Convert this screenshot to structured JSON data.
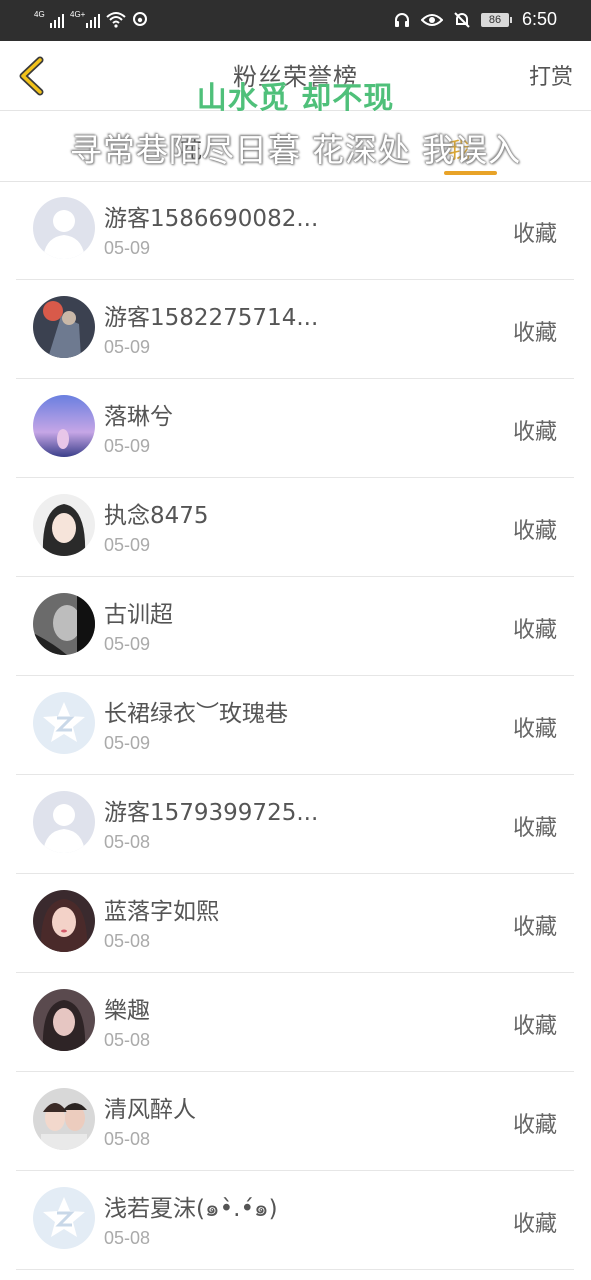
{
  "status_bar": {
    "net1": "4G",
    "net2": "4G+",
    "battery": "86",
    "time": "6:50"
  },
  "header": {
    "title": "粉丝荣誉榜",
    "right_action": "打赏",
    "overlay_text": "山水觅 却不现"
  },
  "tabs": {
    "left_label": "花",
    "right_label": "我",
    "overlay_text": "寻常巷陌尽日暮 花深处 我误入"
  },
  "list": [
    {
      "name": "游客1586690082...",
      "date": "05-09",
      "action": "收藏",
      "avatar": "default-person"
    },
    {
      "name": "游客1582275714...",
      "date": "05-09",
      "action": "收藏",
      "avatar": "warrior"
    },
    {
      "name": "落琳兮",
      "date": "05-09",
      "action": "收藏",
      "avatar": "sunset-girl"
    },
    {
      "name": "执念8475",
      "date": "05-09",
      "action": "收藏",
      "avatar": "anime-girl"
    },
    {
      "name": "古训超",
      "date": "05-09",
      "action": "收藏",
      "avatar": "man-bw"
    },
    {
      "name": "长裙绿衣︶玫瑰巷",
      "date": "05-09",
      "action": "收藏",
      "avatar": "qq-default"
    },
    {
      "name": "游客1579399725...",
      "date": "05-08",
      "action": "收藏",
      "avatar": "default-person"
    },
    {
      "name": "蓝落字如熙",
      "date": "05-08",
      "action": "收藏",
      "avatar": "girl-portrait"
    },
    {
      "name": "樂趣",
      "date": "05-08",
      "action": "收藏",
      "avatar": "girl-dark"
    },
    {
      "name": "清风醉人",
      "date": "05-08",
      "action": "收藏",
      "avatar": "couple"
    },
    {
      "name": "浅若夏沫(๑•̀.•́๑)",
      "date": "05-08",
      "action": "收藏",
      "avatar": "qq-default"
    }
  ],
  "colors": {
    "accent": "#e8a328",
    "overlay_green": "#4fc07a",
    "status_bar_bg": "#2f2f2f"
  }
}
